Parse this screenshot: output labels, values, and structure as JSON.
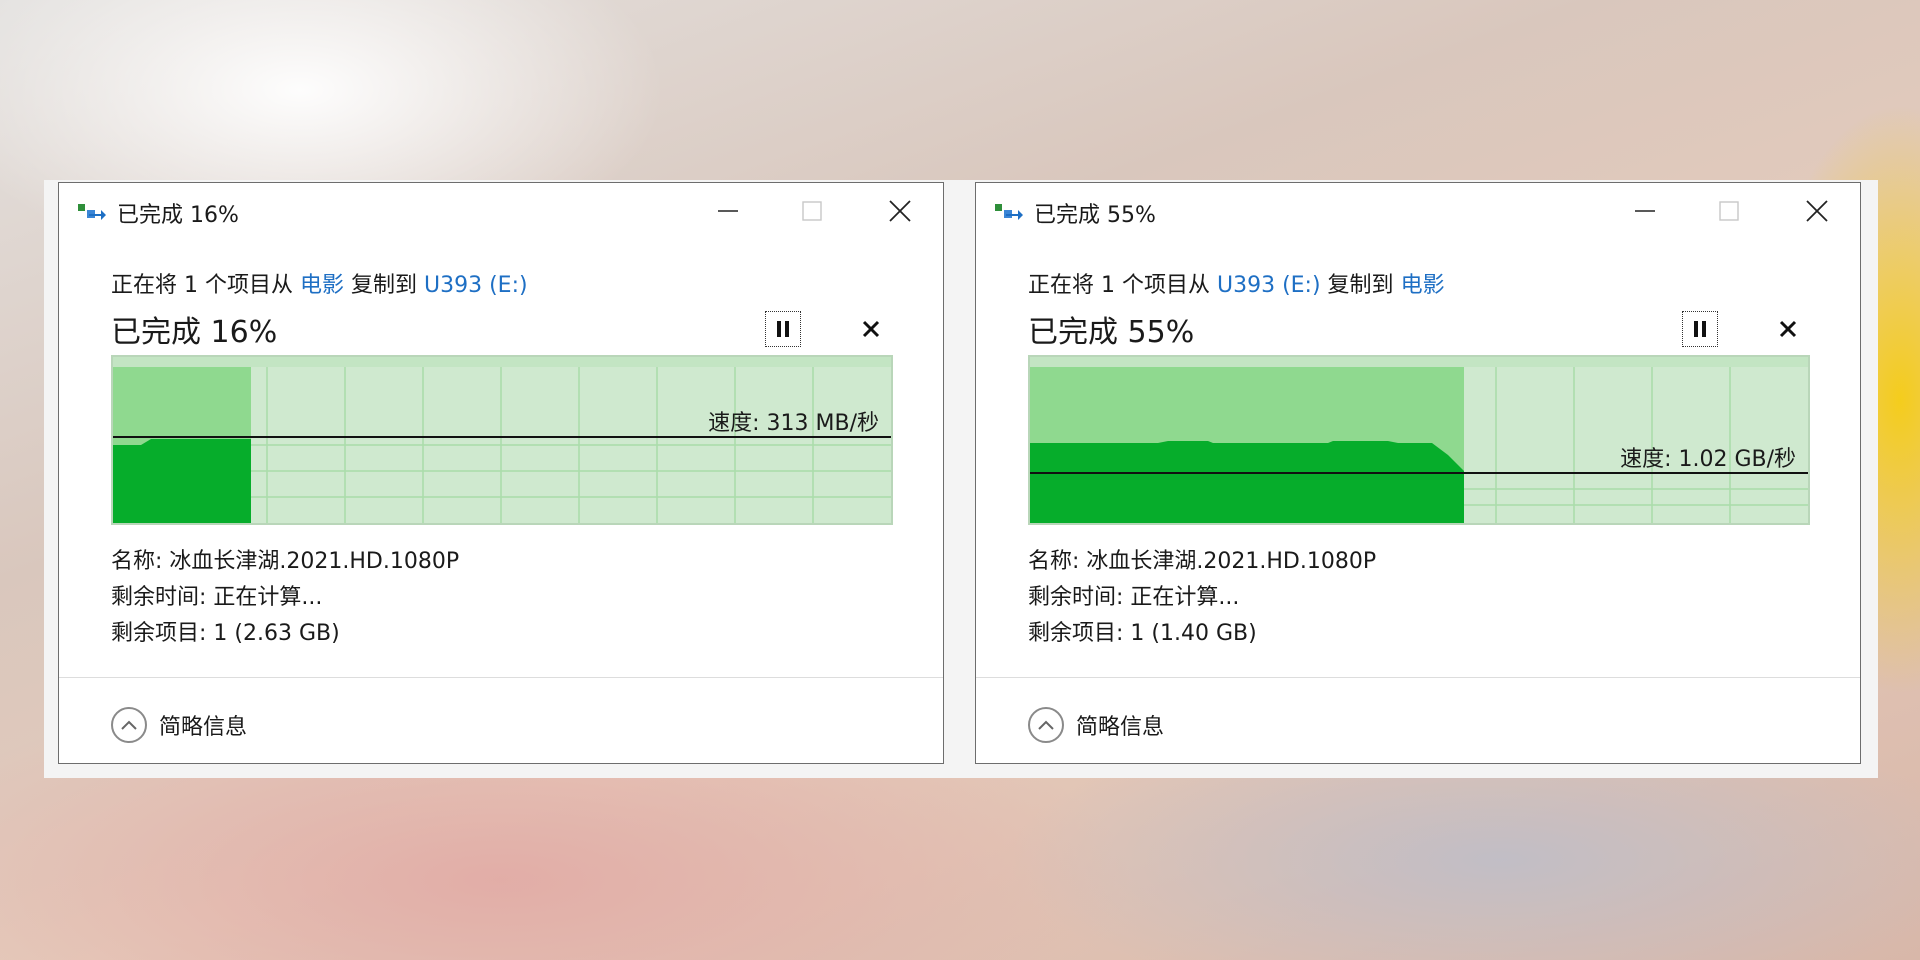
{
  "colors": {
    "accent_link": "#1e6fc4",
    "graph_bg": "#cfe9cf",
    "graph_done": "#8fd98f",
    "graph_fill": "#06ad2b",
    "graph_grid": "#a9dca9"
  },
  "windows": [
    {
      "title": "已完成 16%",
      "copy_desc_prefix": "正在将 1 个项目从 ",
      "source": "电影",
      "copy_desc_middle": " 复制到 ",
      "destination": "U393 (E:)",
      "percent_text": "已完成 16%",
      "progress": 0.16,
      "speed_text": "速度: 313 MB/秒",
      "name_text": "名称: 冰血长津湖.2021.HD.1080P",
      "time_remaining_text": "剩余时间: 正在计算...",
      "items_remaining_text": "剩余项目: 1 (2.63 GB)",
      "details_toggle_label": "简略信息"
    },
    {
      "title": "已完成 55%",
      "copy_desc_prefix": "正在将 1 个项目从 ",
      "source": "U393 (E:)",
      "copy_desc_middle": " 复制到 ",
      "destination": "电影",
      "percent_text": "已完成 55%",
      "progress": 0.55,
      "speed_text": "速度: 1.02 GB/秒",
      "name_text": "名称: 冰血长津湖.2021.HD.1080P",
      "time_remaining_text": "剩余时间: 正在计算...",
      "items_remaining_text": "剩余项目: 1 (1.40 GB)",
      "details_toggle_label": "简略信息"
    }
  ]
}
